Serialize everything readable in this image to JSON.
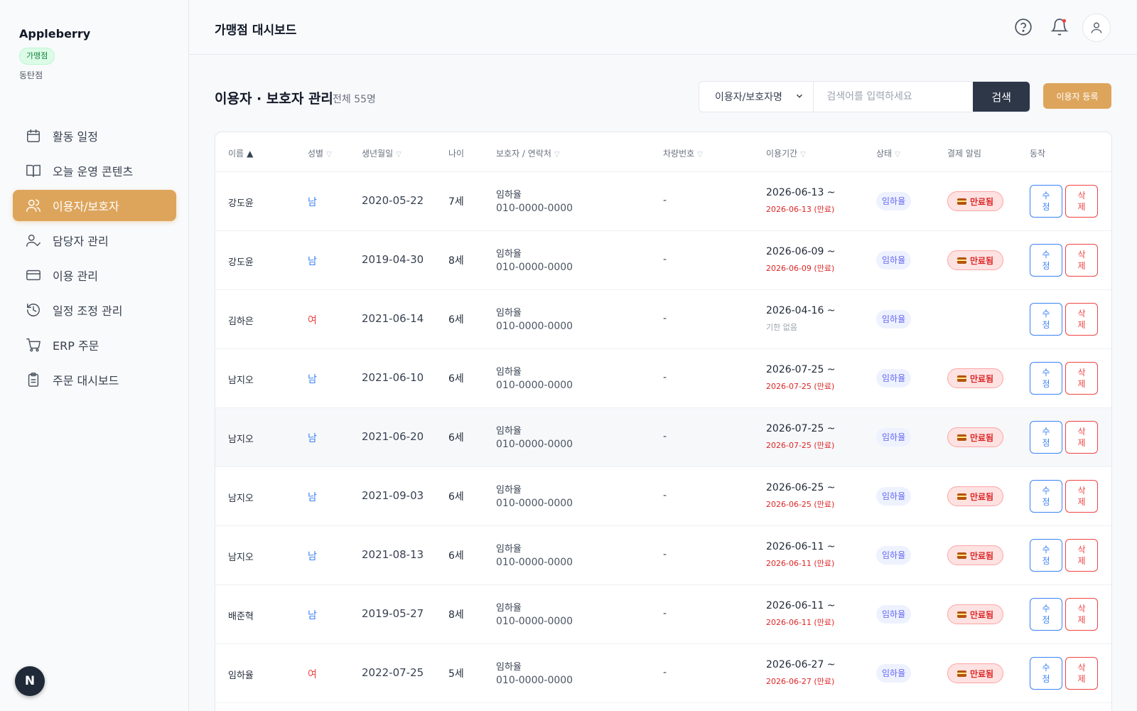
{
  "sidebar": {
    "brand": "Appleberry",
    "badge": "가맹점",
    "branch": "동탄점",
    "items": [
      {
        "label": "활동 일정",
        "icon": "calendar-icon"
      },
      {
        "label": "오늘 운영 콘텐츠",
        "icon": "book-icon"
      },
      {
        "label": "이용자/보호자",
        "icon": "users-icon",
        "active": true
      },
      {
        "label": "담당자 관리",
        "icon": "user-check-icon"
      },
      {
        "label": "이용 관리",
        "icon": "credit-card-icon"
      },
      {
        "label": "일정 조정 관리",
        "icon": "history-icon"
      },
      {
        "label": "ERP 주문",
        "icon": "cart-icon"
      },
      {
        "label": "주문 대시보드",
        "icon": "clipboard-icon"
      }
    ],
    "fab_label": "N"
  },
  "header": {
    "title": "가맹점 대시보드"
  },
  "main": {
    "heading": "이용자 · 보호자 관리",
    "count": "전체 55명",
    "search": {
      "select_value": "이용자/보호자명",
      "placeholder": "검색어를 입력하세요",
      "button": "검색"
    },
    "register_button": "이용자 등록"
  },
  "table": {
    "columns": [
      {
        "label": "이름",
        "sort": "▲"
      },
      {
        "label": "성별",
        "sort": "▽"
      },
      {
        "label": "생년월일",
        "sort": "▽"
      },
      {
        "label": "나이",
        "sort": ""
      },
      {
        "label": "보호자 / 연락처",
        "sort": "▽"
      },
      {
        "label": "차량번호",
        "sort": "▽"
      },
      {
        "label": "이용기간",
        "sort": "▽"
      },
      {
        "label": "상태",
        "sort": "▽"
      },
      {
        "label": "결제 알림",
        "sort": ""
      },
      {
        "label": "동작",
        "sort": ""
      }
    ],
    "edit_label": "수정",
    "delete_label": "삭제",
    "rows": [
      {
        "name": "강도윤",
        "gender": "남",
        "birth": "2020-05-22",
        "age": "7세",
        "guardian": "임하율",
        "phone": "010-0000-0000",
        "car": "-",
        "period": "2026-06-13 ~",
        "end": "2026-06-13 (만료)",
        "end_type": "exp",
        "status": "임하율",
        "pay": "만료됨"
      },
      {
        "name": "강도윤",
        "gender": "남",
        "birth": "2019-04-30",
        "age": "8세",
        "guardian": "임하율",
        "phone": "010-0000-0000",
        "car": "-",
        "period": "2026-06-09 ~",
        "end": "2026-06-09 (만료)",
        "end_type": "exp",
        "status": "임하율",
        "pay": "만료됨"
      },
      {
        "name": "김하은",
        "gender": "여",
        "birth": "2021-06-14",
        "age": "6세",
        "guardian": "임하율",
        "phone": "010-0000-0000",
        "car": "-",
        "period": "2026-04-16 ~",
        "end": "기한 없음",
        "end_type": "none",
        "status": "임하율",
        "pay": ""
      },
      {
        "name": "남지오",
        "gender": "남",
        "birth": "2021-06-10",
        "age": "6세",
        "guardian": "임하율",
        "phone": "010-0000-0000",
        "car": "-",
        "period": "2026-07-25 ~",
        "end": "2026-07-25 (만료)",
        "end_type": "exp",
        "status": "임하율",
        "pay": "만료됨"
      },
      {
        "name": "남지오",
        "gender": "남",
        "birth": "2021-06-20",
        "age": "6세",
        "guardian": "임하율",
        "phone": "010-0000-0000",
        "car": "-",
        "period": "2026-07-25 ~",
        "end": "2026-07-25 (만료)",
        "end_type": "exp",
        "status": "임하율",
        "pay": "만료됨",
        "highlight": true
      },
      {
        "name": "남지오",
        "gender": "남",
        "birth": "2021-09-03",
        "age": "6세",
        "guardian": "임하율",
        "phone": "010-0000-0000",
        "car": "-",
        "period": "2026-06-25 ~",
        "end": "2026-06-25 (만료)",
        "end_type": "exp",
        "status": "임하율",
        "pay": "만료됨"
      },
      {
        "name": "남지오",
        "gender": "남",
        "birth": "2021-08-13",
        "age": "6세",
        "guardian": "임하율",
        "phone": "010-0000-0000",
        "car": "-",
        "period": "2026-06-11 ~",
        "end": "2026-06-11 (만료)",
        "end_type": "exp",
        "status": "임하율",
        "pay": "만료됨"
      },
      {
        "name": "배준혁",
        "gender": "남",
        "birth": "2019-05-27",
        "age": "8세",
        "guardian": "임하율",
        "phone": "010-0000-0000",
        "car": "-",
        "period": "2026-06-11 ~",
        "end": "2026-06-11 (만료)",
        "end_type": "exp",
        "status": "임하율",
        "pay": "만료됨"
      },
      {
        "name": "임하율",
        "gender": "여",
        "birth": "2022-07-25",
        "age": "5세",
        "guardian": "임하율",
        "phone": "010-0000-0000",
        "car": "-",
        "period": "2026-06-27 ~",
        "end": "2026-06-27 (만료)",
        "end_type": "exp",
        "status": "임하율",
        "pay": "만료됨"
      }
    ]
  },
  "colors": {
    "accent": "#dda55c",
    "male": "#3b82f6",
    "female": "#ef4444",
    "expired": "#dc2626"
  }
}
